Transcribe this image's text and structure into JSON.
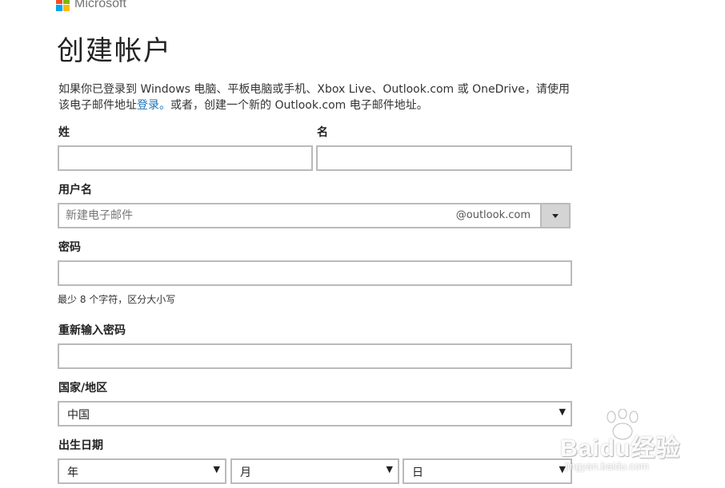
{
  "brand": {
    "name": "Microsoft",
    "colors": [
      "#f25022",
      "#7fba00",
      "#00a4ef",
      "#ffb900"
    ]
  },
  "page_title": "创建帐户",
  "intro": {
    "text_before": "如果你已登录到 Windows 电脑、平板电脑或手机、Xbox Live、Outlook.com 或 OneDrive，请使用该电子邮件地址",
    "link_label": "登录。",
    "text_after": "或者，创建一个新的 Outlook.com 电子邮件地址。"
  },
  "form": {
    "surname_label": "姓",
    "surname_value": "",
    "given_name_label": "名",
    "given_name_value": "",
    "username_label": "用户名",
    "username_placeholder": "新建电子邮件",
    "username_domain": "@outlook.com",
    "password_label": "密码",
    "password_value": "",
    "password_hint": "最少 8 个字符，区分大小写",
    "reenter_password_label": "重新输入密码",
    "reenter_password_value": "",
    "country_label": "国家/地区",
    "country_value": "中国",
    "birthdate_label": "出生日期",
    "year_value": "年",
    "month_value": "月",
    "day_value": "日",
    "select_arrow": "▼"
  },
  "watermark": {
    "text": "Baidu经验",
    "url_text": "jingyan.baidu.com"
  }
}
